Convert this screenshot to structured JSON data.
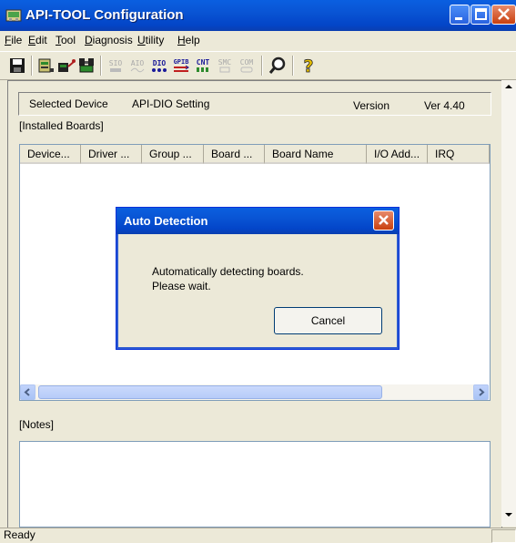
{
  "window": {
    "title": "API-TOOL Configuration",
    "icon": "api-tool-app-icon"
  },
  "menu": [
    {
      "label": "File",
      "mnemonic": "F",
      "rest": "ile"
    },
    {
      "label": "Edit",
      "mnemonic": "E",
      "rest": "dit"
    },
    {
      "label": "Tool",
      "mnemonic": "T",
      "rest": "ool"
    },
    {
      "label": "Diagnosis",
      "mnemonic": "D",
      "rest": "iagnosis"
    },
    {
      "label": "Utility",
      "mnemonic": "U",
      "rest": "tility"
    },
    {
      "label": "Help",
      "mnemonic": "H",
      "rest": "elp"
    }
  ],
  "toolbar": {
    "buttons": [
      {
        "name": "save-icon",
        "text": ""
      },
      {
        "name": "board-icon",
        "text": ""
      },
      {
        "name": "driver-icon",
        "text": ""
      },
      {
        "name": "search-board-icon",
        "text": ""
      },
      {
        "name": "sio-icon",
        "text": "SIO"
      },
      {
        "name": "aio-icon",
        "text": "AIO"
      },
      {
        "name": "dio-icon",
        "text": "DIO"
      },
      {
        "name": "gpib-icon",
        "text": "GPIB"
      },
      {
        "name": "cnt-icon",
        "text": "CNT"
      },
      {
        "name": "smc-icon",
        "text": "SMC"
      },
      {
        "name": "com-icon",
        "text": "COM"
      },
      {
        "name": "magnifier-icon",
        "text": ""
      },
      {
        "name": "help-icon",
        "text": "?"
      }
    ]
  },
  "device": {
    "selected_label": "Selected Device",
    "selected_value": "API-DIO Setting",
    "version_label": "Version",
    "version_value": "Ver 4.40"
  },
  "installed_label": "[Installed Boards]",
  "columns": [
    "Device...",
    "Driver ...",
    "Group ...",
    "Board ...",
    "Board Name",
    "I/O Add...",
    "IRQ"
  ],
  "notes_label": "[Notes]",
  "status": "Ready",
  "dialog": {
    "title": "Auto Detection",
    "message_line1": "Automatically detecting boards.",
    "message_line2": "Please wait.",
    "cancel_label": "Cancel"
  },
  "colors": {
    "titlebar": "#0a5fe0",
    "face": "#ece9d8",
    "close": "#c9400f"
  }
}
